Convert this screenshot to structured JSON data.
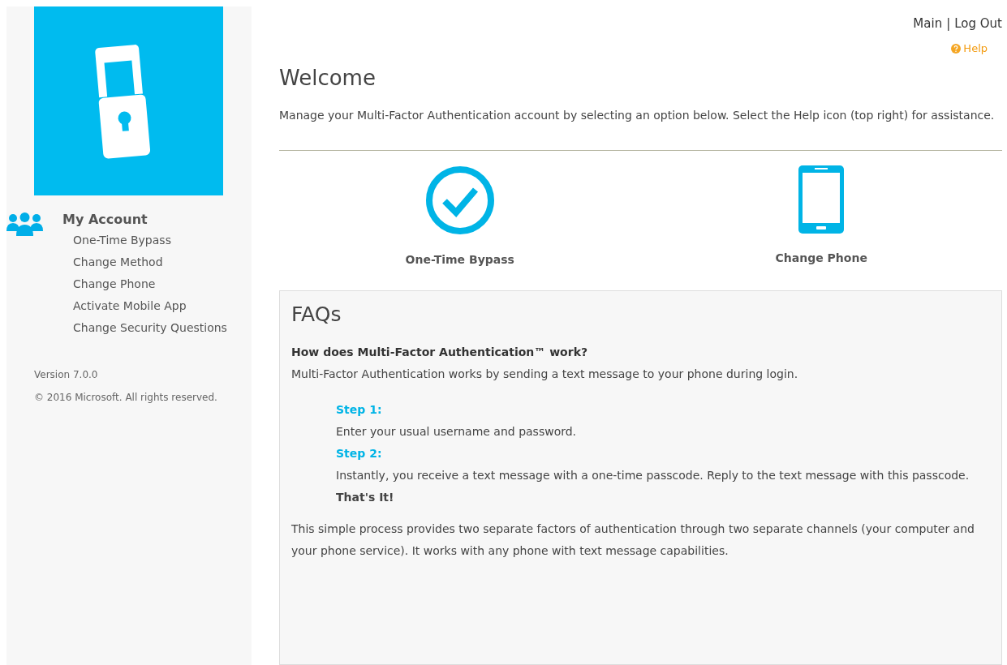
{
  "sidebar": {
    "section_title": "My Account",
    "items": [
      {
        "label": "One-Time Bypass"
      },
      {
        "label": "Change Method"
      },
      {
        "label": "Change Phone"
      },
      {
        "label": "Activate Mobile App"
      },
      {
        "label": "Change Security Questions"
      }
    ],
    "version": "Version 7.0.0",
    "copyright": "© 2016 Microsoft. All rights reserved."
  },
  "header": {
    "links": [
      {
        "label": "Main"
      },
      {
        "label": "Log Out"
      }
    ],
    "separator": "|",
    "help": "Help"
  },
  "welcome": {
    "title": "Welcome",
    "intro": "Manage your Multi-Factor Authentication account by selecting an option below. Select the Help icon (top right) for assistance."
  },
  "tiles": [
    {
      "kind": "check",
      "label": "One-Time Bypass"
    },
    {
      "kind": "phone",
      "label": "Change Phone"
    }
  ],
  "faq": {
    "title": "FAQs",
    "question": "How does Multi-Factor Authentication™ work?",
    "answer": "Multi-Factor Authentication works by sending a text message to your phone during login.",
    "steps": [
      {
        "kind": "heading",
        "text": "Step 1:"
      },
      {
        "kind": "text",
        "text": "Enter your usual username and password."
      },
      {
        "kind": "heading",
        "text": "Step 2:"
      },
      {
        "kind": "text",
        "text": "Instantly, you receive a text message with a one-time passcode. Reply to the text message with this passcode."
      },
      {
        "kind": "closing",
        "text": "That's It!"
      }
    ],
    "summary": "This simple process provides two separate factors of authentication through two separate channels (your computer and your phone service). It works with any phone with text message capabilities."
  }
}
